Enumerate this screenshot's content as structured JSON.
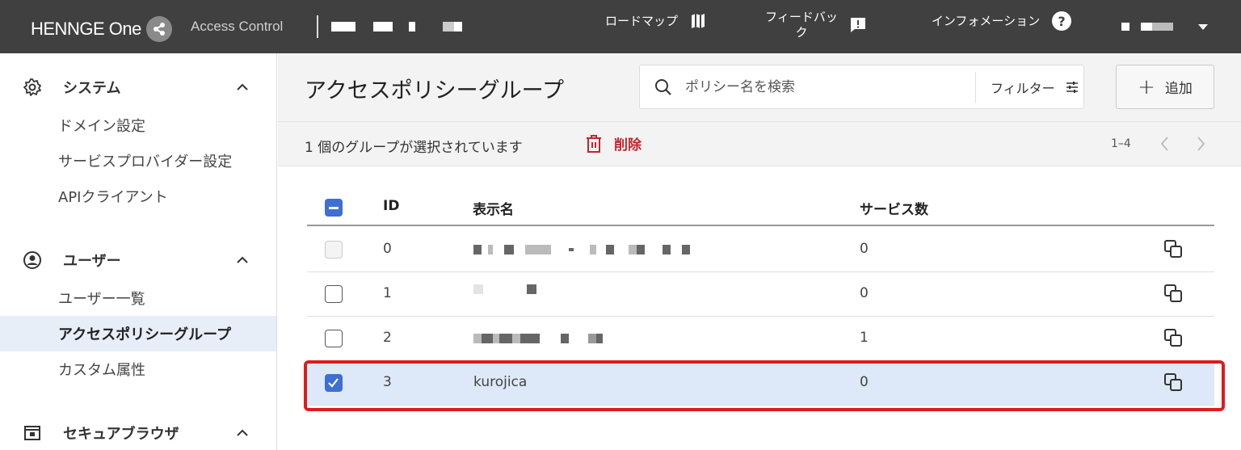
{
  "topbar": {
    "logo_text": "HENNGE One",
    "product": "Access Control",
    "nav": [
      {
        "label": "ロードマップ",
        "icon": "map-icon"
      },
      {
        "label": "フィードバック",
        "icon": "feedback-icon"
      },
      {
        "label": "インフォメーション",
        "icon": "help-icon"
      }
    ],
    "user_menu_icon": "caret-down-icon"
  },
  "sidebar": {
    "sections": [
      {
        "title": "システム",
        "icon": "gear-icon",
        "items": [
          "ドメイン設定",
          "サービスプロバイダー設定",
          "APIクライアント"
        ]
      },
      {
        "title": "ユーザー",
        "icon": "user-circle-icon",
        "items": [
          "ユーザー一覧",
          "アクセスポリシーグループ",
          "カスタム属性"
        ]
      },
      {
        "title": "セキュアブラウザ",
        "icon": "browser-icon",
        "items": []
      }
    ],
    "active_item": "アクセスポリシーグループ"
  },
  "main": {
    "title": "アクセスポリシーグループ",
    "search": {
      "placeholder": "ポリシー名を検索",
      "value": ""
    },
    "filter_label": "フィルター",
    "add_label": "追加",
    "selection": {
      "count_text": "1 個のグループが選択されています",
      "delete_label": "削除"
    },
    "pager": {
      "range": "1–4"
    },
    "table": {
      "headers": {
        "id": "ID",
        "name": "表示名",
        "services": "サービス数"
      },
      "rows": [
        {
          "id": "0",
          "name": "",
          "services": "0",
          "checked": false,
          "disabled": true
        },
        {
          "id": "1",
          "name": "",
          "services": "0",
          "checked": false,
          "disabled": false
        },
        {
          "id": "2",
          "name": "",
          "services": "1",
          "checked": false,
          "disabled": false
        },
        {
          "id": "3",
          "name": "kurojica",
          "services": "0",
          "checked": true,
          "disabled": false
        }
      ]
    }
  },
  "colors": {
    "topbar": "#404040",
    "accent": "#3f6fd0",
    "danger": "#c4252d",
    "selected_row": "#dde9f8",
    "highlight": "#e01a1a"
  }
}
